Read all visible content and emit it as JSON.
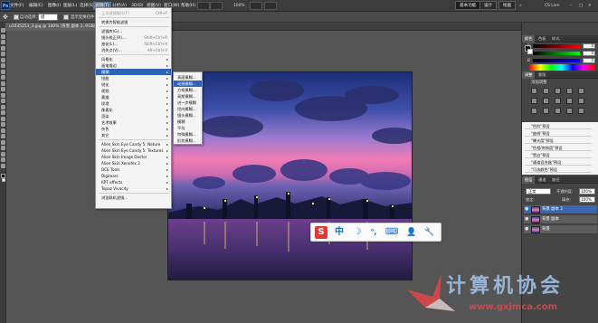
{
  "app": {
    "logo": "Ps"
  },
  "menubar": {
    "items": [
      "文件(F)",
      "编辑(E)",
      "图像(I)",
      "图层(L)",
      "选择(S)",
      "滤镜(T)",
      "分析(A)",
      "3D(D)",
      "视图(V)",
      "窗口(W)",
      "帮助(H)"
    ],
    "active_index": 5,
    "zoom": "100%",
    "workspace_buttons": [
      "基本功能",
      "设计",
      "绘画"
    ],
    "more": "»",
    "cslive": "CS Live"
  },
  "optionsbar": {
    "auto_select_label": "自动选择:",
    "auto_select_value": "组",
    "show_transform_label": "显示变换控件"
  },
  "document_tab": {
    "title": "u1035253_3.jpg @ 100% (背景 副本 2, RGB/8) *"
  },
  "filter_menu": {
    "items": [
      {
        "label": "上次滤镜操作(F)",
        "shortcut": "Ctrl+F",
        "disabled": true
      },
      {
        "sep": true
      },
      {
        "label": "转换为智能滤镜"
      },
      {
        "sep": true
      },
      {
        "label": "滤镜库(G)..."
      },
      {
        "label": "镜头校正(R)...",
        "shortcut": "Shift+Ctrl+R"
      },
      {
        "label": "液化(L)...",
        "shortcut": "Shift+Ctrl+X"
      },
      {
        "label": "消失点(V)...",
        "shortcut": "Alt+Ctrl+V"
      },
      {
        "sep": true
      },
      {
        "label": "风格化",
        "sub": true
      },
      {
        "label": "画笔描边",
        "sub": true
      },
      {
        "label": "模糊",
        "sub": true,
        "highlight": true
      },
      {
        "label": "扭曲",
        "sub": true
      },
      {
        "label": "锐化",
        "sub": true
      },
      {
        "label": "视频",
        "sub": true
      },
      {
        "label": "素描",
        "sub": true
      },
      {
        "label": "纹理",
        "sub": true
      },
      {
        "label": "像素化",
        "sub": true
      },
      {
        "label": "渲染",
        "sub": true
      },
      {
        "label": "艺术效果",
        "sub": true
      },
      {
        "label": "杂色",
        "sub": true
      },
      {
        "label": "其它",
        "sub": true
      },
      {
        "sep": true
      },
      {
        "label": "Alien Skin Eye Candy 5: Nature",
        "sub": true
      },
      {
        "label": "Alien Skin Eye Candy 5: Textures",
        "sub": true
      },
      {
        "label": "Alien Skin Image Doctor",
        "sub": true
      },
      {
        "label": "Alien Skin Xenofex 2",
        "sub": true
      },
      {
        "label": "DCE Tools",
        "sub": true
      },
      {
        "label": "Digimarc",
        "sub": true
      },
      {
        "label": "KPT effects",
        "sub": true
      },
      {
        "label": "Topaz Vivacity",
        "sub": true
      },
      {
        "sep": true
      },
      {
        "label": "浏览联机滤镜..."
      }
    ]
  },
  "blur_submenu": {
    "items": [
      "表面模糊...",
      "动感模糊...",
      "方框模糊...",
      "高斯模糊...",
      "进一步模糊",
      "径向模糊...",
      "镜头模糊...",
      "模糊",
      "平均",
      "特殊模糊...",
      "形状模糊..."
    ],
    "highlight_index": 1
  },
  "ime_bar": {
    "icons": [
      "S",
      "中",
      "☽",
      "°,",
      "⌨",
      "👤",
      "🔧"
    ]
  },
  "right_panel": {
    "top_tabs": [
      "颜色",
      "色板",
      "样式"
    ],
    "color_sliders": [
      {
        "label": "R",
        "value": "0"
      },
      {
        "label": "G",
        "value": "0"
      },
      {
        "label": "B",
        "value": "0"
      }
    ],
    "adjust_tabs": [
      "调整",
      "蒙版"
    ],
    "adjust_title": "添加调整",
    "presets": [
      "\"色阶\"预设",
      "\"曲线\"预设",
      "\"曝光度\"预设",
      "\"色相/饱和度\"预设",
      "\"黑白\"预设",
      "\"通道混合器\"预设",
      "\"可选颜色\"预设"
    ],
    "layer_tabs": [
      "图层",
      "通道",
      "路径"
    ],
    "blend_mode": "正常",
    "opacity_label": "不透明度:",
    "opacity_value": "100%",
    "lock_label": "锁定:",
    "fill_label": "填充:",
    "fill_value": "100%",
    "layers": [
      {
        "name": "背景 副本 2",
        "active": true
      },
      {
        "name": "背景 副本",
        "active": false
      },
      {
        "name": "背景",
        "active": false
      }
    ]
  },
  "watermark": {
    "text": "计算机协会",
    "url": "www.gxjmca.com"
  }
}
